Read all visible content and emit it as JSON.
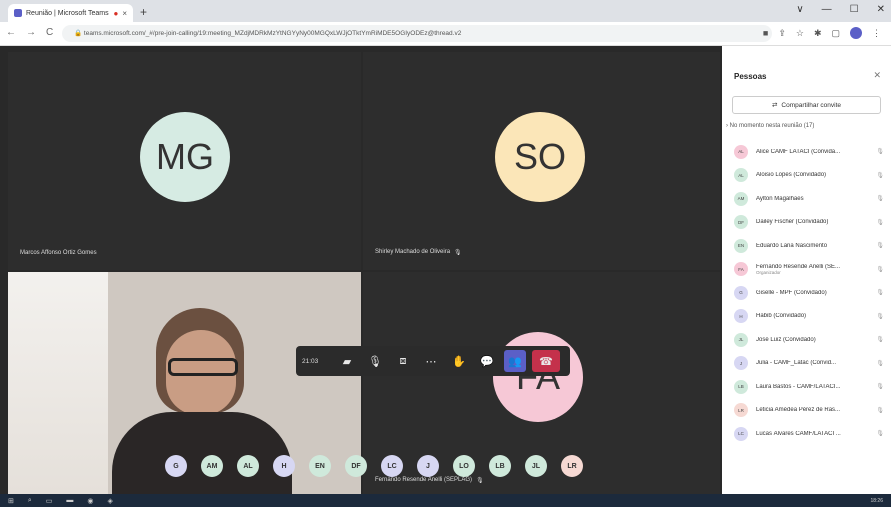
{
  "browser": {
    "tab_title": "Reunião | Microsoft Teams",
    "tab_close": "×",
    "new_tab": "+",
    "window_controls": [
      "∨",
      "—",
      "☐",
      "✕"
    ],
    "nav": [
      "←",
      "→",
      "C"
    ],
    "url": "teams.microsoft.com/_#/pre-join-calling/19:meeting_MZdjMDRkMzYtNGYyNy00MGQxLWJjOTktYmRiMDE5OGIyODEz@thread.v2"
  },
  "tiles": [
    {
      "initials": "MG",
      "name": "Marcos Affonso Ortiz Gomes",
      "color": "#d6ebe3"
    },
    {
      "initials": "SO",
      "name": "Shirley Machado de Oliveira",
      "color": "#fbe6b8"
    },
    {
      "initials": "",
      "name": ""
    },
    {
      "initials": "FA",
      "name": "Fernando Resende Anelli (SEPLAG)",
      "color": "#f6c8d6"
    }
  ],
  "call_controls": {
    "timer": "21:03"
  },
  "roster": [
    {
      "initials": "G",
      "color": "#d7d7f3"
    },
    {
      "initials": "AM",
      "color": "#cfe9db"
    },
    {
      "initials": "AL",
      "color": "#cfe9db"
    },
    {
      "initials": "H",
      "color": "#d7d7f3"
    },
    {
      "initials": "EN",
      "color": "#cfe9db"
    },
    {
      "initials": "DF",
      "color": "#cfe9db"
    },
    {
      "initials": "LC",
      "color": "#d7d7f3"
    },
    {
      "initials": "J",
      "color": "#d7d7f3"
    },
    {
      "initials": "LO",
      "color": "#cfe9db"
    },
    {
      "initials": "LB",
      "color": "#cfe9db"
    },
    {
      "initials": "JL",
      "color": "#cfe9db"
    },
    {
      "initials": "LR",
      "color": "#f6d9d3"
    }
  ],
  "panel": {
    "title": "Pessoas",
    "share_label": "Compartilhar convite",
    "section": "No momento nesta reunião (17)",
    "people": [
      {
        "initials": "AL",
        "name": "Alice CAMF LATACI (Convida...",
        "color": "#f6c8d6"
      },
      {
        "initials": "AL",
        "name": "Aloisio Lopes (Convidado)",
        "color": "#cfe9db"
      },
      {
        "initials": "AM",
        "name": "Aylton Magalhaes",
        "color": "#cfe9db"
      },
      {
        "initials": "DF",
        "name": "Dailey Fischer (Convidado)",
        "color": "#cfe9db"
      },
      {
        "initials": "EN",
        "name": "Eduardo Lana Nascimento",
        "color": "#cfe9db"
      },
      {
        "initials": "FA",
        "name": "Fernando Resende Anelli (SE...",
        "sub": "Organizador",
        "color": "#f6c8d6"
      },
      {
        "initials": "G",
        "name": "Giselle - MPF (Convidado)",
        "color": "#d7d7f3"
      },
      {
        "initials": "H",
        "name": "Habib (Convidado)",
        "color": "#d7d7f3"
      },
      {
        "initials": "JL",
        "name": "José Luiz (Convidado)",
        "color": "#cfe9db"
      },
      {
        "initials": "J",
        "name": "Julia - CAMF_Latac (Convid...",
        "color": "#d7d7f3"
      },
      {
        "initials": "LB",
        "name": "Laura Bastos - CAMF/LATACI...",
        "color": "#cfe9db"
      },
      {
        "initials": "LR",
        "name": "Leticia Amédea Pérez de Ras...",
        "color": "#f6d9d3"
      },
      {
        "initials": "LC",
        "name": "Lucas Álvares CAMF/LATACI ...",
        "color": "#d7d7f3"
      }
    ]
  },
  "taskbar": {
    "clock": "18:26"
  }
}
